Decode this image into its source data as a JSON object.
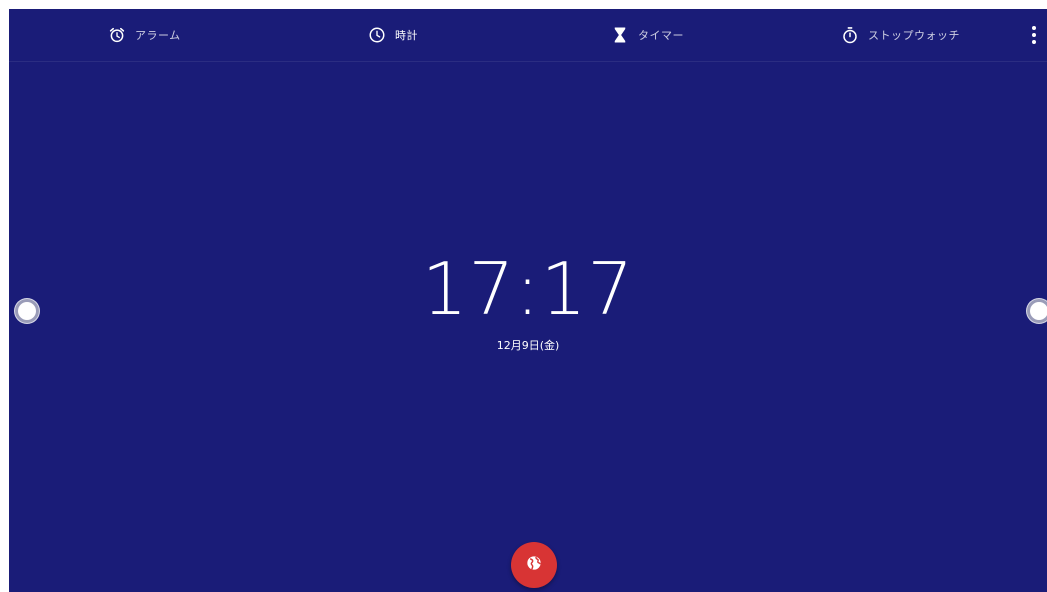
{
  "tabs": {
    "alarm": {
      "label": "アラーム",
      "icon": "alarm-clock-icon"
    },
    "clock": {
      "label": "時計",
      "icon": "clock-icon"
    },
    "timer": {
      "label": "タイマー",
      "icon": "hourglass-icon"
    },
    "stopwatch": {
      "label": "ストップウォッチ",
      "icon": "stopwatch-icon"
    }
  },
  "active_tab": "clock",
  "clock": {
    "time": "17:17",
    "date": "12月9日(金)"
  },
  "fab": {
    "icon": "globe-icon",
    "color": "#d83434"
  },
  "colors": {
    "background": "#1a1c78",
    "text": "#ffffff"
  }
}
